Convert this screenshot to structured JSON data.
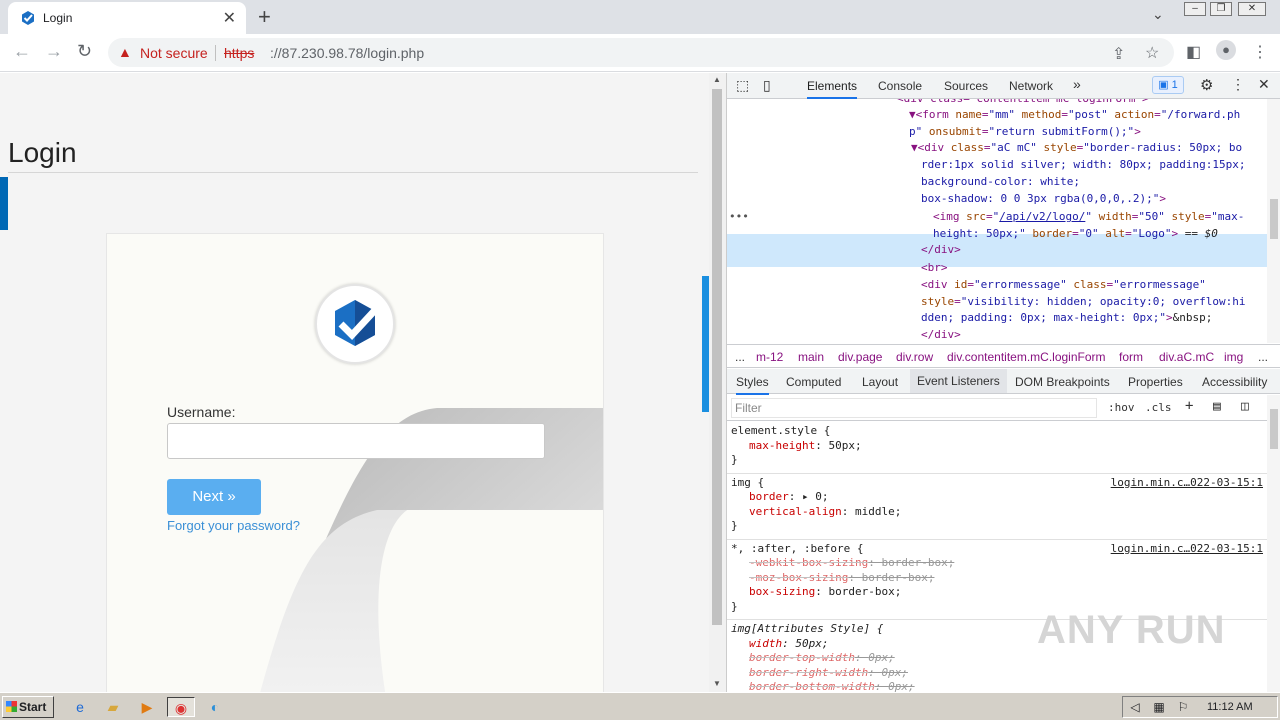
{
  "browser": {
    "tab_title": "Login",
    "tab_close": "✕",
    "new_tab": "+",
    "security_label": "Not secure",
    "url_scheme": "https",
    "url_rest": "://87.230.98.78/login.php"
  },
  "page": {
    "title": "Login",
    "username_label": "Username:",
    "next_button": "Next »",
    "forgot_link": "Forgot your password?"
  },
  "devtools": {
    "tabs": [
      "Elements",
      "Console",
      "Sources",
      "Network"
    ],
    "more_tabs": "»",
    "issues_count": "1",
    "dom_lines": [
      {
        "indent": 170,
        "html": "<span>&lt;div class=\"contentitem mC loginForm\"&gt;</span>"
      },
      {
        "indent": 182,
        "html": "<span>▼&lt;form </span><span class=\"an\">name</span>=<span class=\"av\">\"mm\"</span> <span class=\"an\">method</span>=<span class=\"av\">\"post\"</span> <span class=\"an\">action</span>=<span class=\"av\">\"/forward.ph</span>"
      },
      {
        "indent": 182,
        "html": "<span class=\"av\">p\"</span> <span class=\"an\">onsubmit</span>=<span class=\"av\">\"return submitForm();\"</span>&gt;"
      },
      {
        "indent": 184,
        "html": "<span>▼&lt;div </span><span class=\"an\">class</span>=<span class=\"av\">\"aC mC\"</span> <span class=\"an\">style</span>=<span class=\"av\">\"border-radius: 50px; bo</span>"
      },
      {
        "indent": 194,
        "html": "<span class=\"av\">rder:1px solid silver; width: 80px; padding:15px;</span>"
      },
      {
        "indent": 194,
        "html": "<span class=\"av\">background-color: white;</span>"
      },
      {
        "indent": 194,
        "html": "<span class=\"av\">box-shadow: 0 0 3px rgba(0,0,0,.2);\"</span>&gt;"
      },
      {
        "indent": 206,
        "html": "&lt;img <span class=\"an\">src</span>=<span class=\"av\">\"<u>/api/v2/logo/</u>\"</span> <span class=\"an\">width</span>=<span class=\"av\">\"50\"</span> <span class=\"an\">style</span>=<span class=\"av\">\"max-</span>"
      },
      {
        "indent": 206,
        "html": "<span class=\"av\">height: 50px;\"</span> <span class=\"an\">border</span>=<span class=\"av\">\"0\"</span> <span class=\"an\">alt</span>=<span class=\"av\">\"Logo\"</span>&gt; <span class=\"tx\">== <i>$0</i></span>"
      },
      {
        "indent": 194,
        "html": "&lt;/div&gt;"
      },
      {
        "indent": 194,
        "html": "&lt;br&gt;"
      },
      {
        "indent": 194,
        "html": "&lt;div <span class=\"an\">id</span>=<span class=\"av\">\"errormessage\"</span> <span class=\"an\">class</span>=<span class=\"av\">\"errormessage\"</span>"
      },
      {
        "indent": 194,
        "html": "<span class=\"an\">style</span>=<span class=\"av\">\"visibility: hidden; opacity:0; overflow:hi</span>"
      },
      {
        "indent": 194,
        "html": "<span class=\"av\">dden; padding: 0px; max-height: 0px;\"</span>&gt;<span class=\"tx\">&amp;nbsp;</span>"
      },
      {
        "indent": 194,
        "html": "&lt;/div&gt;"
      }
    ],
    "dom_ellipsis": "•••",
    "crumbs": [
      "...",
      "m-12",
      "main",
      "div.page",
      "div.row",
      "div.contentitem.mC.loginForm",
      "form",
      "div.aC.mC",
      "img",
      "..."
    ],
    "styles_tabs": [
      "Styles",
      "Computed",
      "Layout",
      "Event Listeners",
      "DOM Breakpoints",
      "Properties",
      "Accessibility"
    ],
    "filter_placeholder": "Filter",
    "hov": ":hov",
    "cls": ".cls",
    "watermark": "ANY RUN",
    "rules": [
      {
        "selector": "element.style {",
        "source": "",
        "props": [
          {
            "name": "max-height",
            "value": "50px;",
            "strike": false,
            "ital": false
          }
        ]
      },
      {
        "selector": "img {",
        "source": "login.min.c…022-03-15:1",
        "props": [
          {
            "name": "border",
            "value": "▸ 0;",
            "strike": false,
            "ital": false
          },
          {
            "name": "vertical-align",
            "value": "middle;",
            "strike": false,
            "ital": false
          }
        ]
      },
      {
        "selector": "*, :after, :before {",
        "source": "login.min.c…022-03-15:1",
        "props": [
          {
            "name": "-webkit-box-sizing",
            "value": "border-box;",
            "strike": true,
            "ital": false
          },
          {
            "name": "-moz-box-sizing",
            "value": "border-box;",
            "strike": true,
            "ital": false
          },
          {
            "name": "box-sizing",
            "value": "border-box;",
            "strike": false,
            "ital": false
          }
        ]
      },
      {
        "selector": "img[Attributes Style] {",
        "source": "",
        "props": [
          {
            "name": "width",
            "value": "50px;",
            "strike": false,
            "ital": true
          },
          {
            "name": "border-top-width",
            "value": "0px;",
            "strike": true,
            "ital": true
          },
          {
            "name": "border-right-width",
            "value": "0px;",
            "strike": true,
            "ital": true
          },
          {
            "name": "border-bottom-width",
            "value": "0px;",
            "strike": true,
            "ital": true
          }
        ]
      }
    ]
  },
  "taskbar": {
    "start_label": "Start",
    "clock": "11:12 AM"
  }
}
